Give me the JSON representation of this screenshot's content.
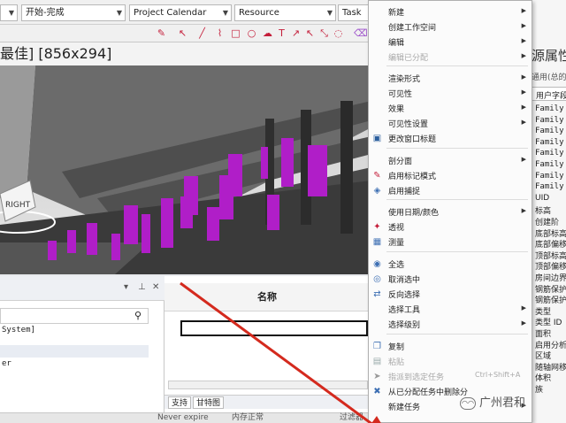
{
  "toolbar": {
    "combo1": "",
    "combo2": "开始-完成",
    "combo3": "Project Calendar",
    "combo4": "Resource",
    "combo5": "Task"
  },
  "viewport": {
    "title": "最佳] [856x294]",
    "viewcube_label": "RIGHT"
  },
  "left_panel": {
    "tree_items": [
      "System]",
      "er"
    ]
  },
  "grid": {
    "column_header": "名称",
    "tabs": [
      "支持",
      "甘特图"
    ]
  },
  "status": {
    "items": [
      "Never expire",
      "内存正常",
      "过滤器"
    ]
  },
  "context_menu": {
    "items": [
      {
        "label": "新建",
        "submenu": true,
        "disabled": false,
        "icon": ""
      },
      {
        "label": "创建工作空间",
        "submenu": true,
        "disabled": false,
        "icon": ""
      },
      {
        "label": "编辑",
        "submenu": true,
        "disabled": false,
        "icon": ""
      },
      {
        "label": "编辑已分配",
        "submenu": true,
        "disabled": true,
        "icon": ""
      },
      {
        "label": "渲染形式",
        "submenu": true,
        "disabled": false,
        "icon": ""
      },
      {
        "label": "可见性",
        "submenu": true,
        "disabled": false,
        "icon": ""
      },
      {
        "label": "效果",
        "submenu": true,
        "disabled": false,
        "icon": ""
      },
      {
        "label": "可见性设置",
        "submenu": true,
        "disabled": false,
        "icon": ""
      },
      {
        "label": "更改窗口标题",
        "submenu": false,
        "disabled": false,
        "icon": "window-icon"
      },
      {
        "label": "剖分面",
        "submenu": true,
        "disabled": false,
        "icon": ""
      },
      {
        "label": "启用标记模式",
        "submenu": false,
        "disabled": false,
        "icon": "markup-icon"
      },
      {
        "label": "启用捕捉",
        "submenu": false,
        "disabled": false,
        "icon": "snap-icon"
      },
      {
        "label": "使用日期/颜色",
        "submenu": true,
        "disabled": false,
        "icon": ""
      },
      {
        "label": "透视",
        "submenu": false,
        "disabled": false,
        "icon": "perspective-icon"
      },
      {
        "label": "测量",
        "submenu": false,
        "disabled": false,
        "icon": "measure-icon"
      },
      {
        "label": "全选",
        "submenu": false,
        "disabled": false,
        "icon": "select-all-icon"
      },
      {
        "label": "取消选中",
        "submenu": false,
        "disabled": false,
        "icon": "deselect-icon"
      },
      {
        "label": "反向选择",
        "submenu": false,
        "disabled": false,
        "icon": "invert-selection-icon"
      },
      {
        "label": "选择工具",
        "submenu": true,
        "disabled": false,
        "icon": ""
      },
      {
        "label": "选择级别",
        "submenu": true,
        "disabled": false,
        "icon": ""
      },
      {
        "label": "复制",
        "submenu": false,
        "disabled": false,
        "icon": "copy-icon"
      },
      {
        "label": "粘贴",
        "submenu": false,
        "disabled": true,
        "icon": "paste-icon"
      },
      {
        "label": "指派到选定任务",
        "submenu": false,
        "disabled": true,
        "icon": "assign-icon",
        "shortcut": "Ctrl+Shift+A"
      },
      {
        "label": "从已分配任务中删除分",
        "submenu": false,
        "disabled": false,
        "icon": "remove-assign-icon"
      },
      {
        "label": "新建任务",
        "submenu": true,
        "disabled": false,
        "icon": ""
      }
    ]
  },
  "properties": {
    "title": "源属性",
    "subtitle": "通用(总的",
    "header": "用户字段",
    "rows": [
      "Family",
      "Family",
      "Family",
      "Family",
      "Family",
      "Family",
      "Family",
      "Family",
      "UID",
      "标高",
      "创建阶",
      "底部标高",
      "底部偏移",
      "顶部标高",
      "顶部偏移",
      "房间边界",
      "钢筋保护",
      "钢筋保护",
      "类型",
      "类型 ID",
      "面积",
      "启用分析",
      "区域",
      "随轴网移",
      "体积",
      "族"
    ]
  },
  "watermark": {
    "text": "广州君和"
  },
  "colors": {
    "accent_red": "#d42a1e",
    "menu_bg": "#fbfbfb",
    "magenta": "#b01ec8"
  }
}
